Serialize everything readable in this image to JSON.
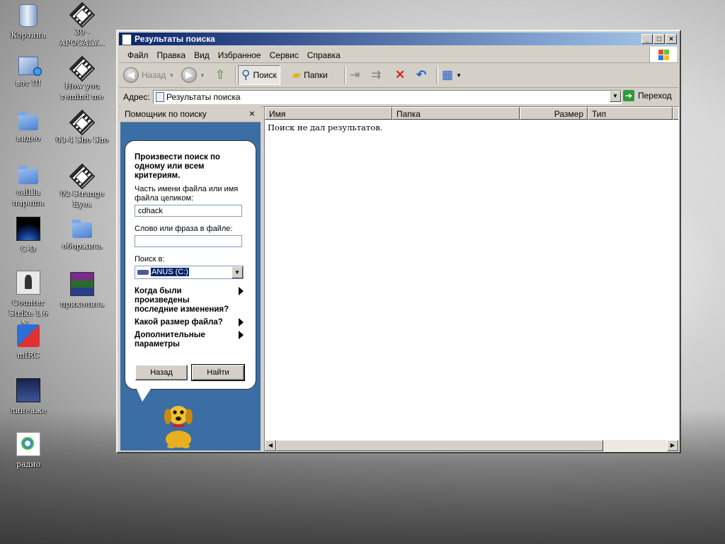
{
  "desktop": {
    "icons": [
      {
        "label": "Корзина"
      },
      {
        "label": "39 - APOCALY..."
      },
      {
        "label": "вот !!!"
      },
      {
        "label": "How you remind me"
      },
      {
        "label": "видео"
      },
      {
        "label": "03-4 Sho Sho"
      },
      {
        "label": "calLla параша"
      },
      {
        "label": "02-Strange Eyes"
      },
      {
        "label": "C-D"
      },
      {
        "label": "оборжись"
      },
      {
        "label": "Counter Strike 1.6 N..."
      },
      {
        "label": "приколись"
      },
      {
        "label": "mIRC"
      },
      {
        "label": "линеаже"
      },
      {
        "label": "радио"
      }
    ]
  },
  "window": {
    "title": "Результаты поиска",
    "controls": {
      "minimize": "_",
      "maximize": "□",
      "close": "×"
    }
  },
  "menu": [
    "Файл",
    "Правка",
    "Вид",
    "Избранное",
    "Сервис",
    "Справка"
  ],
  "toolbar": {
    "back": "Назад",
    "search": "Поиск",
    "folders": "Папки"
  },
  "address": {
    "label": "Адрес:",
    "value": "Результаты поиска",
    "go": "Переход"
  },
  "search_pane": {
    "header": "Помощник по поиску",
    "close": "×",
    "heading": "Произвести поиск по одному или всем критериям.",
    "filename_label": "Часть имени файла или имя файла целиком:",
    "filename_value": "cdhack",
    "phrase_label": "Слово или фраза в файле:",
    "phrase_value": "",
    "lookin_label": "Поиск в:",
    "lookin_value": "ANUS (C:)",
    "options": [
      "Когда были произведены последние изменения?",
      "Какой размер файла?",
      "Дополнительные параметры"
    ],
    "back_button": "Назад",
    "find_button": "Найти"
  },
  "results": {
    "columns": [
      "Имя",
      "Папка",
      "Размер",
      "Тип"
    ],
    "empty_message": "Поиск не дал результатов."
  }
}
